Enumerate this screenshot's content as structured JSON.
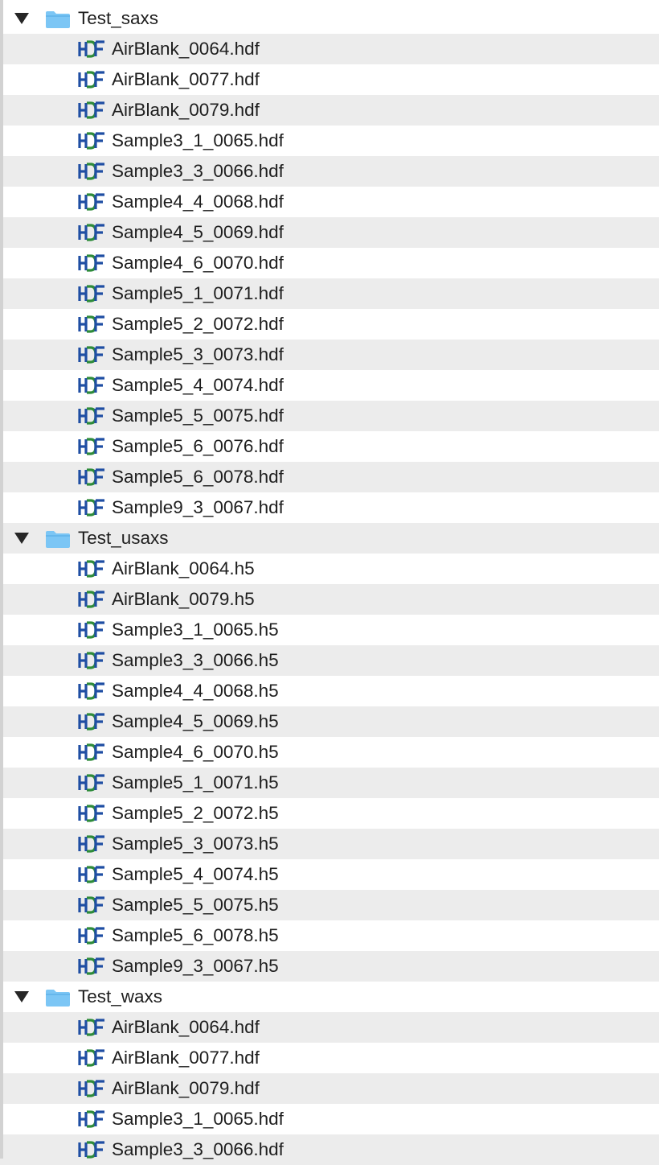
{
  "colors": {
    "row_alt": "#ececec",
    "row_base": "#ffffff",
    "folder_blue": "#7cc6f5",
    "hdf_blue": "#1f4ea3",
    "hdf_green": "#2e8b3a",
    "text": "#1e1e1e"
  },
  "icons": {
    "expand": "disclosure-triangle-down",
    "folder": "folder-icon",
    "file": "hdf-file-icon"
  },
  "tree": [
    {
      "name": "Test_saxs",
      "expanded": true,
      "files": [
        "AirBlank_0064.hdf",
        "AirBlank_0077.hdf",
        "AirBlank_0079.hdf",
        "Sample3_1_0065.hdf",
        "Sample3_3_0066.hdf",
        "Sample4_4_0068.hdf",
        "Sample4_5_0069.hdf",
        "Sample4_6_0070.hdf",
        "Sample5_1_0071.hdf",
        "Sample5_2_0072.hdf",
        "Sample5_3_0073.hdf",
        "Sample5_4_0074.hdf",
        "Sample5_5_0075.hdf",
        "Sample5_6_0076.hdf",
        "Sample5_6_0078.hdf",
        "Sample9_3_0067.hdf"
      ]
    },
    {
      "name": "Test_usaxs",
      "expanded": true,
      "files": [
        "AirBlank_0064.h5",
        "AirBlank_0079.h5",
        "Sample3_1_0065.h5",
        "Sample3_3_0066.h5",
        "Sample4_4_0068.h5",
        "Sample4_5_0069.h5",
        "Sample4_6_0070.h5",
        "Sample5_1_0071.h5",
        "Sample5_2_0072.h5",
        "Sample5_3_0073.h5",
        "Sample5_4_0074.h5",
        "Sample5_5_0075.h5",
        "Sample5_6_0078.h5",
        "Sample9_3_0067.h5"
      ]
    },
    {
      "name": "Test_waxs",
      "expanded": true,
      "files": [
        "AirBlank_0064.hdf",
        "AirBlank_0077.hdf",
        "AirBlank_0079.hdf",
        "Sample3_1_0065.hdf",
        "Sample3_3_0066.hdf"
      ]
    }
  ]
}
